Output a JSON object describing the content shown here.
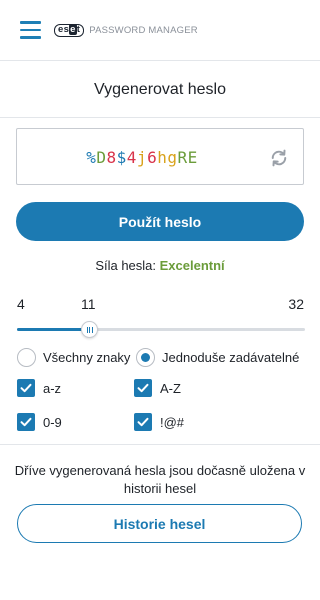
{
  "header": {
    "menu_icon": "hamburger-menu-icon",
    "logo_badge_prefix": "es",
    "logo_badge_mid": "e",
    "logo_badge_suffix": "t",
    "logo_text": "PASSWORD MANAGER"
  },
  "page": {
    "title": "Vygenerovat heslo"
  },
  "password": {
    "value": "%D8$4j6hgRE",
    "refresh_icon": "refresh-icon"
  },
  "actions": {
    "use_password": "Použít heslo",
    "history": "Historie hesel"
  },
  "strength": {
    "label": "Síla hesla:",
    "value": "Excelentní"
  },
  "length_slider": {
    "min": 4,
    "current": 11,
    "max": 32,
    "min_label": "4",
    "current_label": "11",
    "max_label": "32"
  },
  "character_set": {
    "all_chars": {
      "label": "Všechny znaky",
      "selected": false
    },
    "easy_to_type": {
      "label": "Jednoduše zadávatelné",
      "selected": true
    }
  },
  "options": {
    "lowercase": {
      "label": "a-z",
      "checked": true
    },
    "uppercase": {
      "label": "A-Z",
      "checked": true
    },
    "digits": {
      "label": "0-9",
      "checked": true
    },
    "symbols": {
      "label": "!@#",
      "checked": true
    }
  },
  "history_note": "Dříve vygenerovaná hesla jsou dočasně uložena v historii hesel",
  "colors": {
    "accent": "#1c7ab2",
    "strength_excellent": "#6b9c3a",
    "pw_symbol": "#1c7ab2",
    "pw_digit": "#d8334a",
    "pw_upper": "#6b9c3a",
    "pw_lower": "#d9a21b"
  }
}
